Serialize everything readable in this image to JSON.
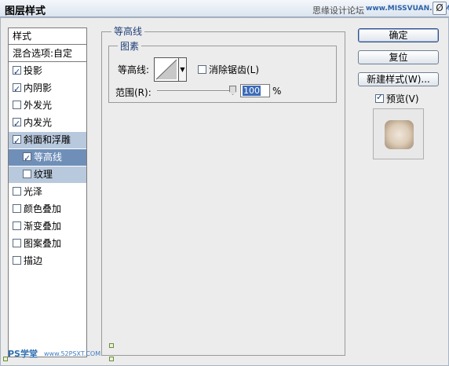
{
  "window": {
    "title": "图层样式",
    "watermark_text": "思缘设计论坛",
    "watermark_site": "www.MISSVUAN.COM",
    "close_symbol": "Ø"
  },
  "styles_list": {
    "header": "样式",
    "blend_options": "混合选项:自定",
    "items": [
      {
        "label": "投影",
        "checked": true
      },
      {
        "label": "内阴影",
        "checked": true
      },
      {
        "label": "外发光",
        "checked": false
      },
      {
        "label": "内发光",
        "checked": true
      },
      {
        "label": "斜面和浮雕",
        "checked": true
      },
      {
        "label": "等高线",
        "checked": true
      },
      {
        "label": "纹理",
        "checked": false
      },
      {
        "label": "光泽",
        "checked": false
      },
      {
        "label": "颜色叠加",
        "checked": false
      },
      {
        "label": "渐变叠加",
        "checked": false
      },
      {
        "label": "图案叠加",
        "checked": false
      },
      {
        "label": "描边",
        "checked": false
      }
    ]
  },
  "contour_panel": {
    "section_title": "等高线",
    "subsection_title": "图素",
    "contour_label": "等高线:",
    "antialias_label": "消除锯齿(L)",
    "antialias_checked": false,
    "range_label": "范围(R):",
    "range_value": "100",
    "range_unit": "%"
  },
  "buttons": {
    "ok": "确定",
    "reset": "复位",
    "new_style": "新建样式(W)...",
    "preview_label": "预览(V)",
    "preview_checked": true
  },
  "footer": {
    "watermark": "PS学堂",
    "watermark_site": "www.52PSXT.COM"
  },
  "colors": {
    "selected_dark": "#6f8fb8",
    "selected_light": "#b9c9dd",
    "legend_text": "#1f3f78"
  }
}
